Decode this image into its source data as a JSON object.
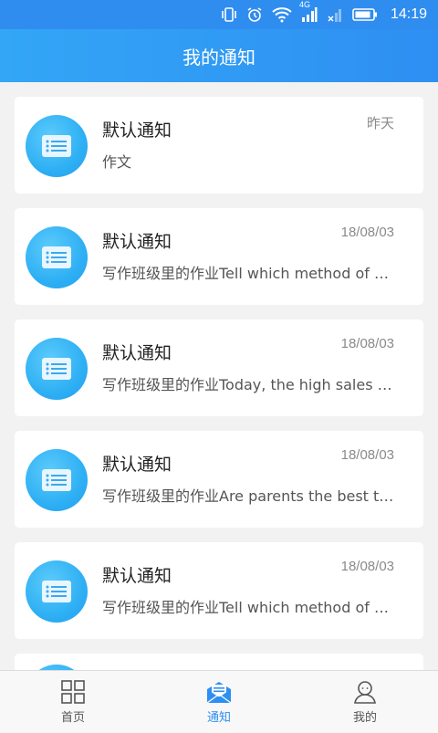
{
  "status_bar": {
    "time": "14:19",
    "network": "4G",
    "icons": [
      "vibrate-icon",
      "alarm-icon",
      "wifi-icon",
      "signal-icon",
      "signal-x-icon",
      "battery-icon"
    ]
  },
  "header": {
    "title": "我的通知"
  },
  "notifications": [
    {
      "title": "默认通知",
      "time": "昨天",
      "preview": "作文"
    },
    {
      "title": "默认通知",
      "time": "18/08/03",
      "preview": "写作班级里的作业Tell which method of …"
    },
    {
      "title": "默认通知",
      "time": "18/08/03",
      "preview": "写作班级里的作业Today, the high sales …"
    },
    {
      "title": "默认通知",
      "time": "18/08/03",
      "preview": "写作班级里的作业Are parents the best t…"
    },
    {
      "title": "默认通知",
      "time": "18/08/03",
      "preview": "写作班级里的作业Tell which method of …"
    }
  ],
  "bottom_nav": {
    "home": "首页",
    "notifications": "通知",
    "mine": "我的",
    "active": "notifications"
  },
  "colors": {
    "accent": "#2e8ff2",
    "avatar": "#2fb0f4",
    "background": "#f2f2f2"
  }
}
